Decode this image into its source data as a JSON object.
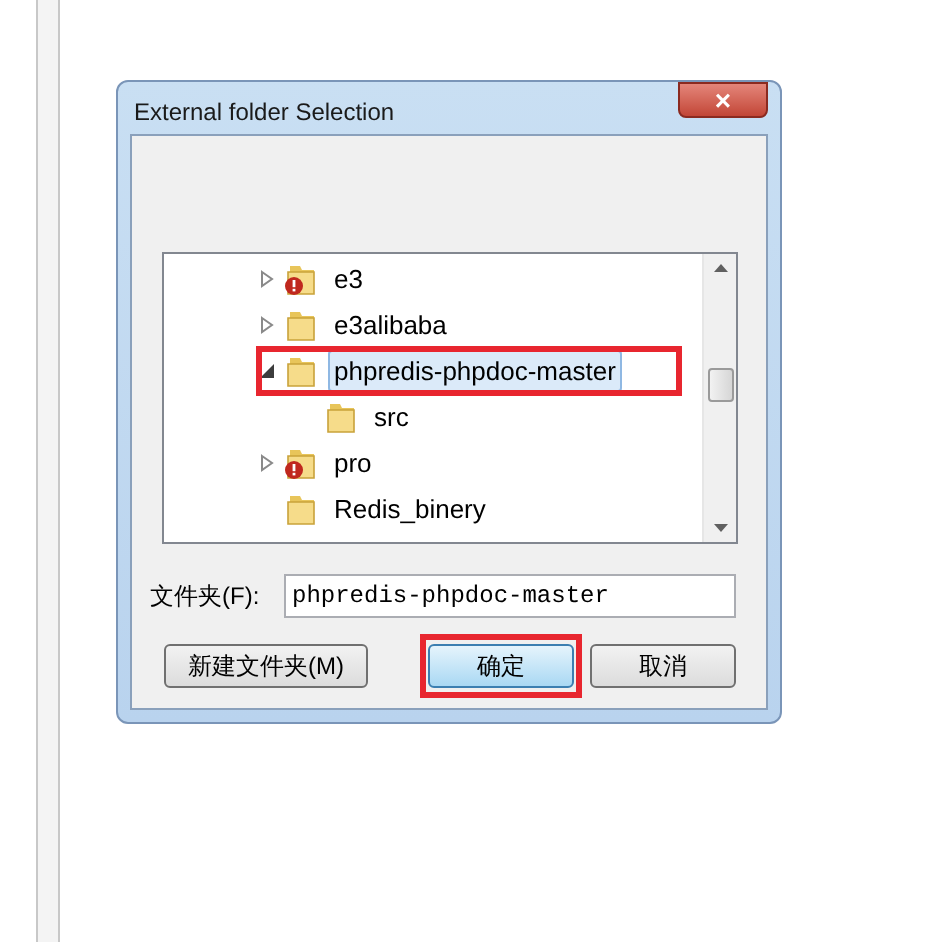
{
  "window": {
    "title": "External folder Selection",
    "close": "×"
  },
  "tree": {
    "items": [
      {
        "label": "e3",
        "kind": "warning-folder",
        "expanded": false,
        "highlighted": false,
        "selected": false
      },
      {
        "label": "e3alibaba",
        "kind": "folder",
        "expanded": false,
        "highlighted": false,
        "selected": false
      },
      {
        "label": "phpredis-phpdoc-master",
        "kind": "folder",
        "expanded": true,
        "highlighted": true,
        "selected": true,
        "children": [
          {
            "label": "src",
            "kind": "folder",
            "highlighted": false,
            "selected": false
          }
        ]
      },
      {
        "label": "pro",
        "kind": "warning-folder",
        "expanded": false,
        "highlighted": false,
        "selected": false
      },
      {
        "label": "Redis_binery",
        "kind": "folder",
        "highlighted": false,
        "selected": false
      }
    ]
  },
  "folder_field": {
    "label": "文件夹(F):",
    "value": "phpredis-phpdoc-master"
  },
  "buttons": [
    {
      "label": "新建文件夹(M)",
      "highlighted": false
    },
    {
      "label": "确定",
      "highlighted": true
    },
    {
      "label": "取消",
      "highlighted": false
    }
  ]
}
